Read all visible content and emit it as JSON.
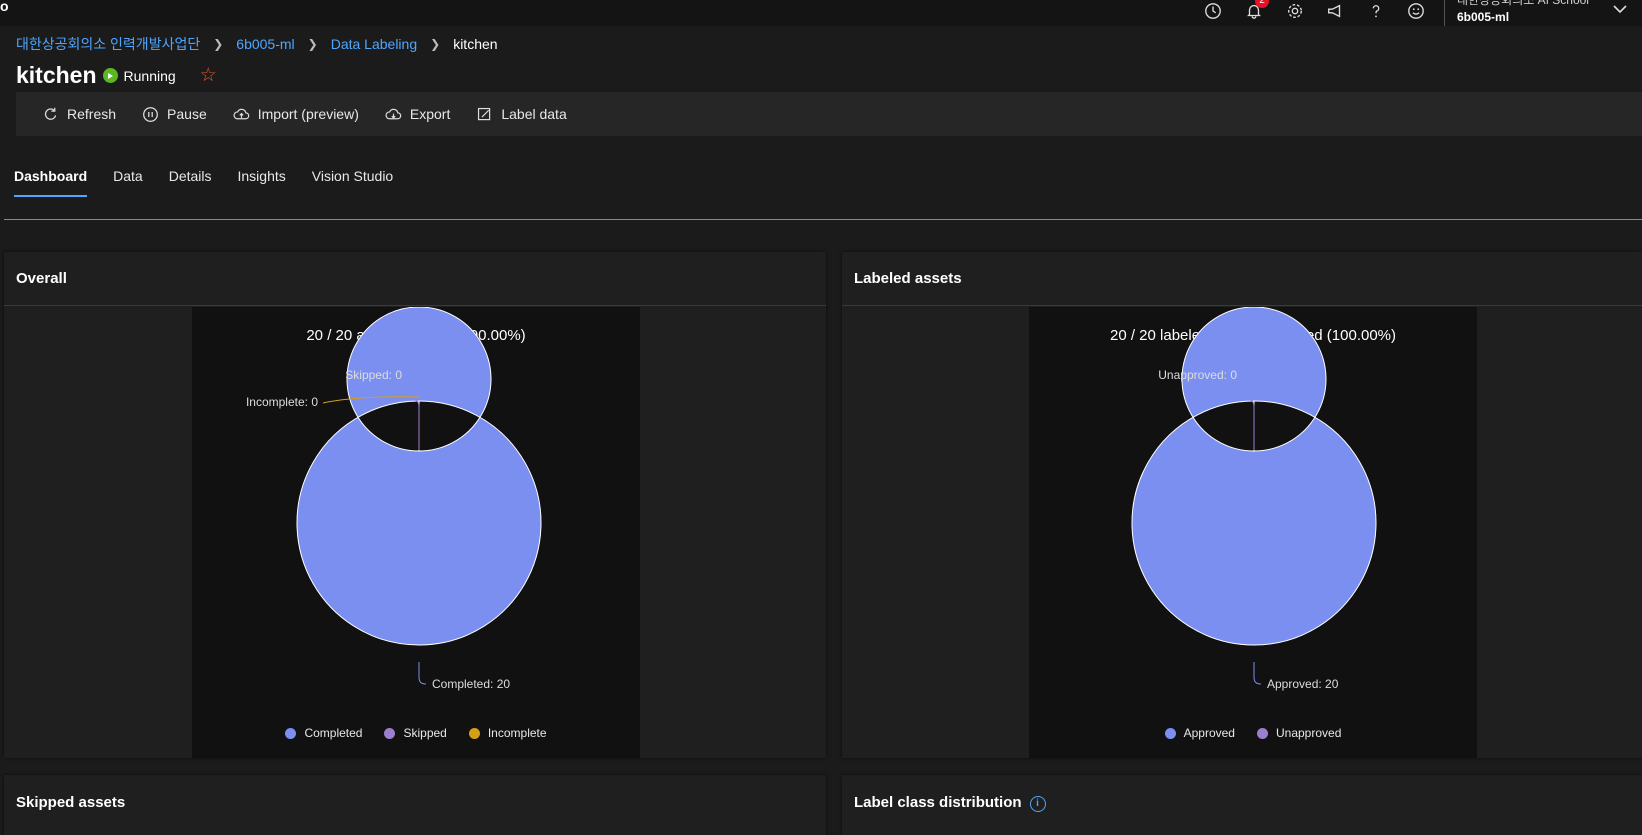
{
  "topbar": {
    "logo_fragment": "o",
    "notifications_count": "2",
    "org_name": "대한상공회의소 AI School",
    "workspace": "6b005-ml"
  },
  "breadcrumb": {
    "items": [
      "대한상공회의소 인력개발사업단",
      "6b005-ml",
      "Data Labeling"
    ],
    "current": "kitchen"
  },
  "page": {
    "title": "kitchen",
    "status": "Running",
    "status_color": "#5ab820"
  },
  "toolbar": {
    "refresh": "Refresh",
    "pause": "Pause",
    "import": "Import (preview)",
    "export": "Export",
    "label_data": "Label data"
  },
  "tabs": [
    "Dashboard",
    "Data",
    "Details",
    "Insights",
    "Vision Studio"
  ],
  "active_tab": "Dashboard",
  "cards": {
    "overall": {
      "title": "Overall",
      "heading": "20 / 20 assets labeled (100.00%)",
      "callouts": {
        "skipped": "Skipped: 0",
        "incomplete": "Incomplete: 0",
        "completed": "Completed: 20"
      },
      "legend": [
        "Completed",
        "Skipped",
        "Incomplete"
      ]
    },
    "labeled": {
      "title": "Labeled assets",
      "heading": "20 / 20 labeled assets approved (100.00%)",
      "callouts": {
        "unapproved": "Unapproved: 0",
        "approved": "Approved: 20"
      },
      "legend": [
        "Approved",
        "Unapproved"
      ]
    },
    "skipped_assets": {
      "title": "Skipped assets"
    },
    "label_class_distribution": {
      "title": "Label class distribution"
    }
  },
  "colors": {
    "completed": "#7b8ff0",
    "skipped": "#9b7fcf",
    "incomplete": "#d4a017",
    "approved": "#7b8ff0",
    "unapproved": "#9b7fcf",
    "accent": "#4ea6ff"
  },
  "chart_data": [
    {
      "type": "pie",
      "title": "20 / 20 assets labeled (100.00%)",
      "categories": [
        "Completed",
        "Skipped",
        "Incomplete"
      ],
      "values": [
        20,
        0,
        0
      ]
    },
    {
      "type": "pie",
      "title": "20 / 20 labeled assets approved (100.00%)",
      "categories": [
        "Approved",
        "Unapproved"
      ],
      "values": [
        20,
        0
      ]
    }
  ]
}
